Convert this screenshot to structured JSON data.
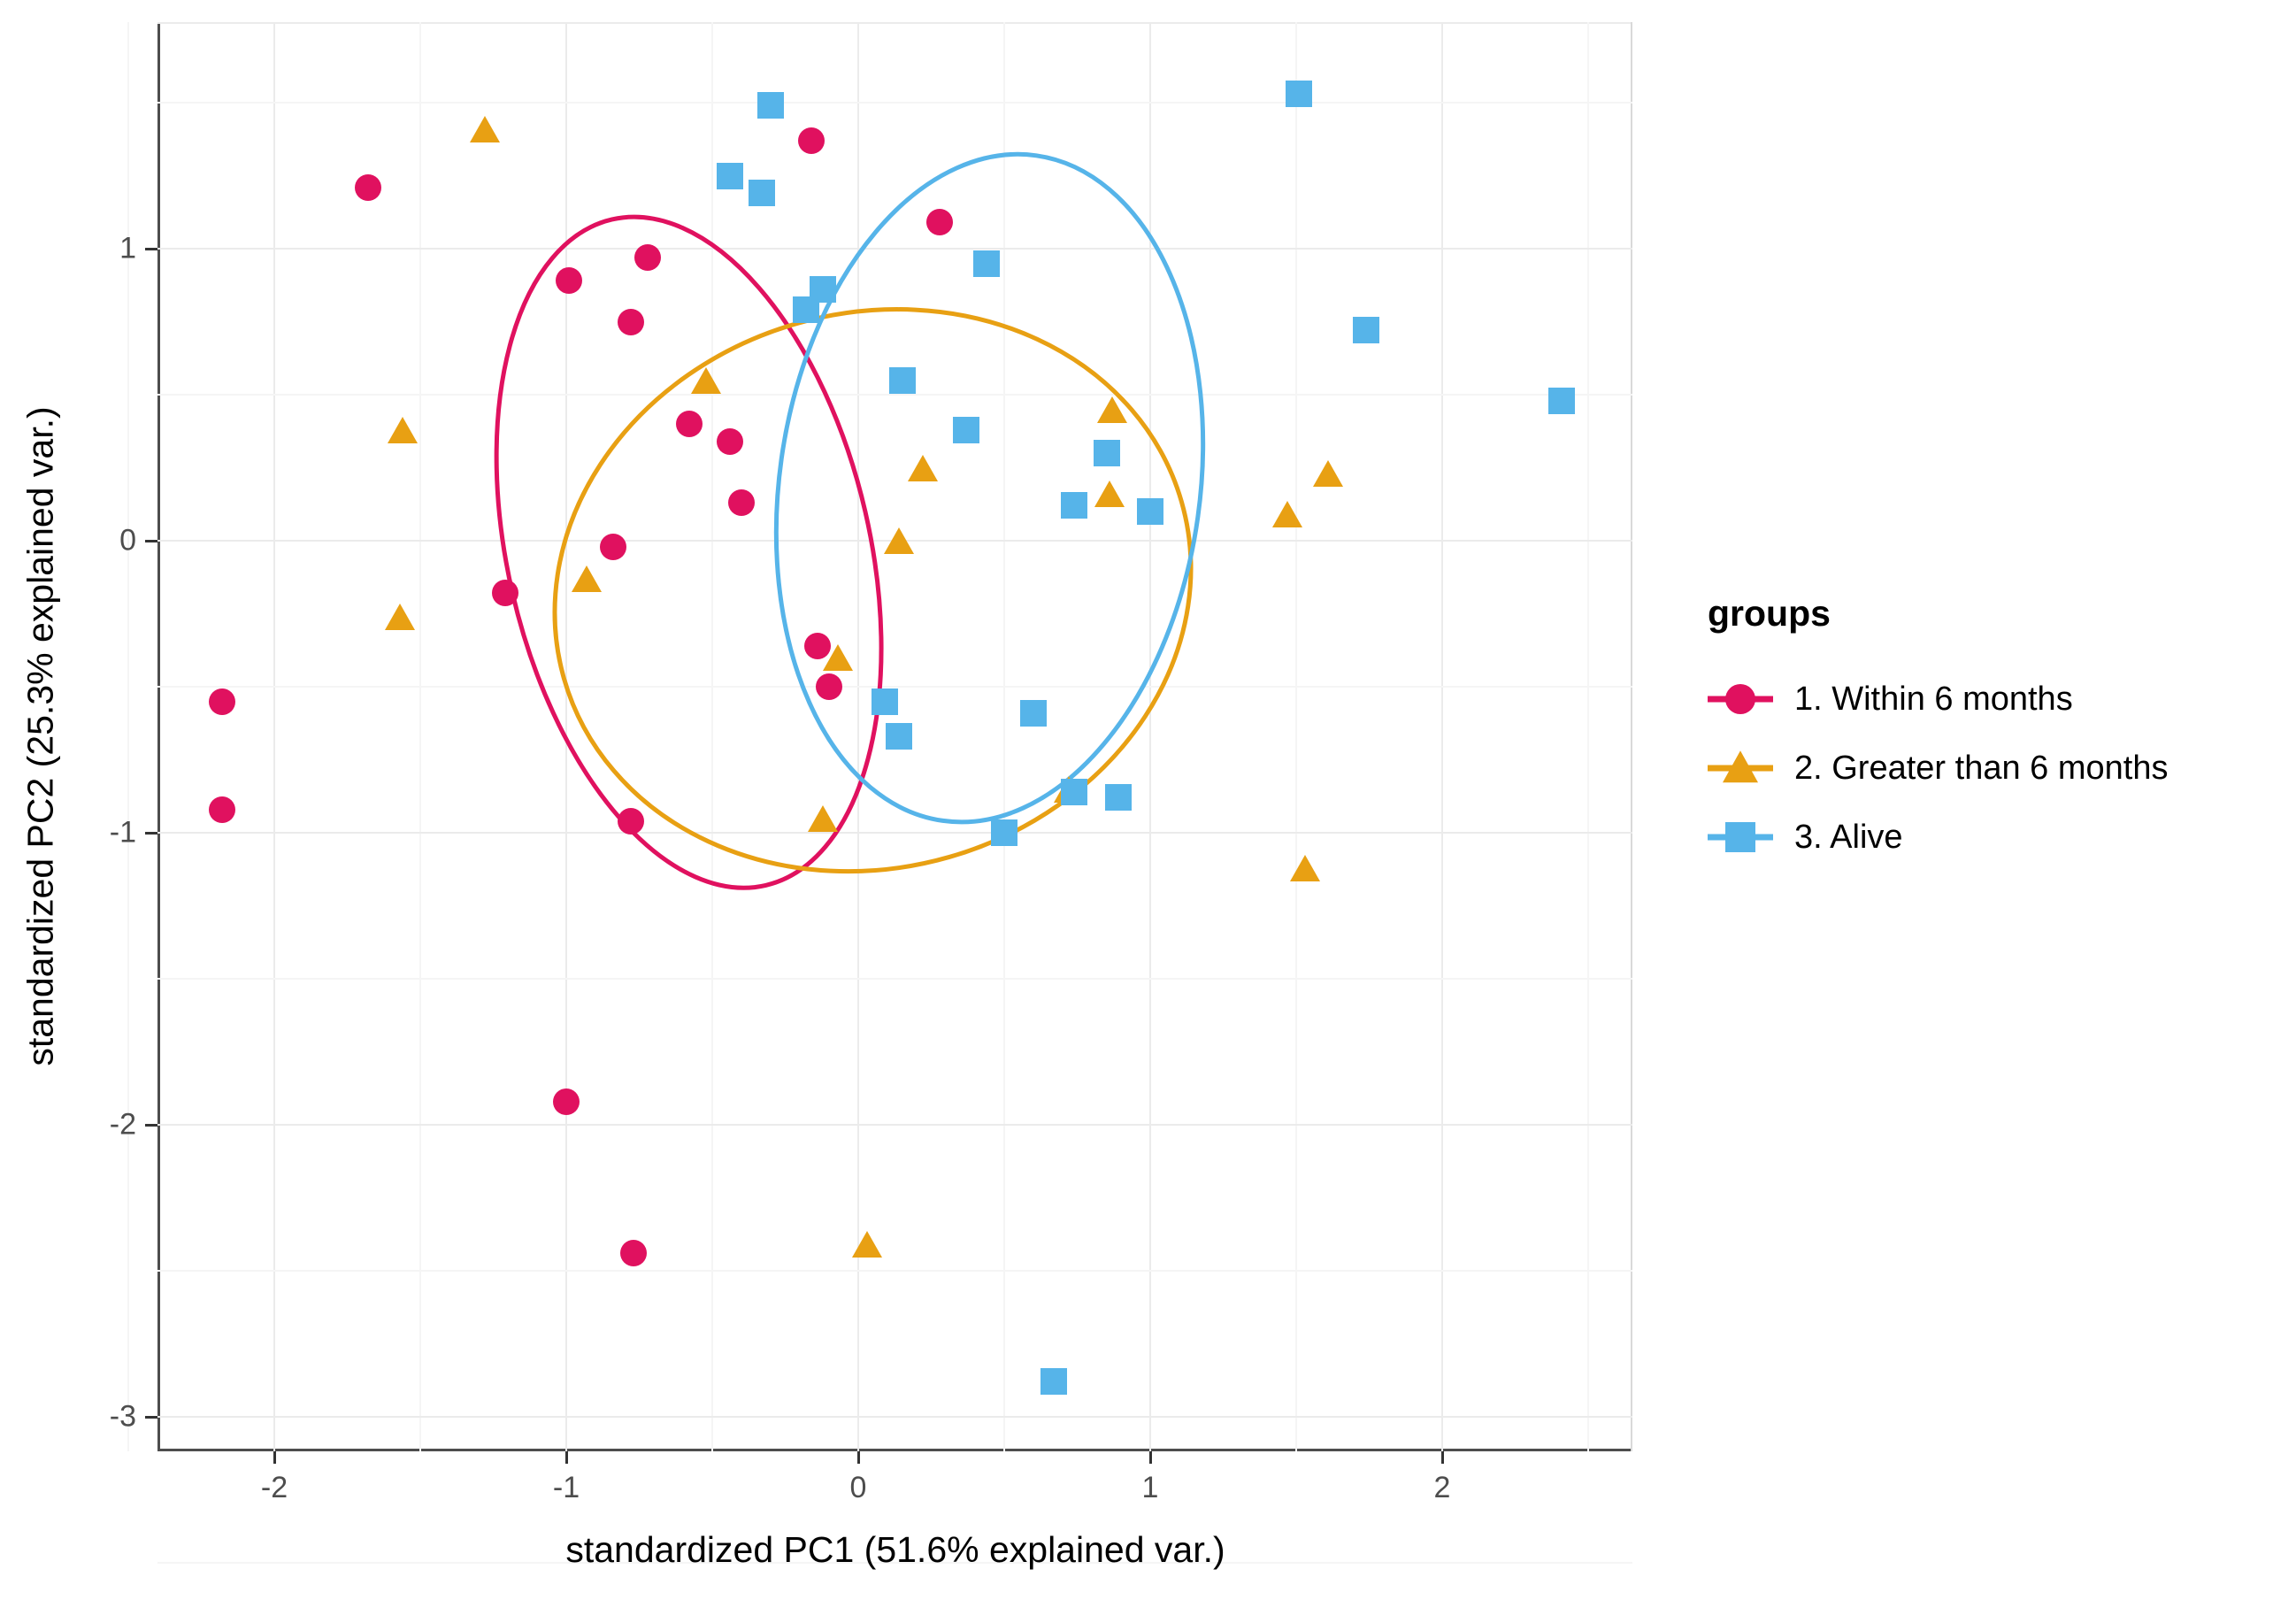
{
  "chart_data": {
    "type": "scatter",
    "title": "",
    "xlabel": "standardized PC1 (51.6% explained var.)",
    "ylabel": "standardized PC2 (25.3% explained var.)",
    "xlim": [
      -2.4,
      2.6
    ],
    "ylim": [
      -3.15,
      1.65
    ],
    "xticks": [
      "-2",
      "-1",
      "0",
      "1",
      "2"
    ],
    "xtick_values": [
      -2,
      -1,
      0,
      1,
      2
    ],
    "yticks": [
      "1",
      "0",
      "-1",
      "-2",
      "-3"
    ],
    "ytick_values": [
      1,
      0,
      -1,
      -2,
      -3
    ],
    "grid": true,
    "legend_position": "right",
    "legend_title": "groups",
    "colors": {
      "group1": "#E0115F",
      "group2": "#E8A013",
      "group3": "#56B4E9"
    },
    "series": [
      {
        "name": "1. Within 6 months",
        "marker": "circle",
        "color": "#E0115F",
        "points": [
          [
            -1.68,
            1.21
          ],
          [
            -0.16,
            1.37
          ],
          [
            -0.99,
            0.89
          ],
          [
            -0.72,
            0.97
          ],
          [
            -0.78,
            0.75
          ],
          [
            0.28,
            1.09
          ],
          [
            -0.58,
            0.4
          ],
          [
            -0.44,
            0.34
          ],
          [
            -0.4,
            0.13
          ],
          [
            -0.84,
            -0.02
          ],
          [
            -1.21,
            -0.18
          ],
          [
            -2.18,
            -0.55
          ],
          [
            -2.18,
            -0.92
          ],
          [
            -0.14,
            -0.36
          ],
          [
            -0.1,
            -0.5
          ],
          [
            -0.78,
            -0.96
          ],
          [
            -1.0,
            -1.92
          ],
          [
            -0.77,
            -2.44
          ]
        ]
      },
      {
        "name": "2. Greater than 6 months",
        "marker": "triangle",
        "color": "#E8A013",
        "points": [
          [
            -1.28,
            1.41
          ],
          [
            -1.56,
            0.38
          ],
          [
            -0.52,
            0.55
          ],
          [
            -0.93,
            -0.13
          ],
          [
            -1.57,
            -0.26
          ],
          [
            0.22,
            0.25
          ],
          [
            0.14,
            0.0
          ],
          [
            0.87,
            0.45
          ],
          [
            0.86,
            0.16
          ],
          [
            1.61,
            0.23
          ],
          [
            1.47,
            0.09
          ],
          [
            -0.07,
            -0.4
          ],
          [
            0.72,
            -0.85
          ],
          [
            -0.12,
            -0.95
          ],
          [
            1.53,
            -1.12
          ],
          [
            0.03,
            -2.41
          ]
        ]
      },
      {
        "name": "3. Alive",
        "marker": "square",
        "color": "#56B4E9",
        "points": [
          [
            -0.3,
            1.49
          ],
          [
            1.51,
            1.53
          ],
          [
            -0.44,
            1.25
          ],
          [
            -0.33,
            1.19
          ],
          [
            -0.12,
            0.86
          ],
          [
            -0.18,
            0.79
          ],
          [
            0.44,
            0.95
          ],
          [
            1.74,
            0.72
          ],
          [
            2.41,
            0.48
          ],
          [
            0.15,
            0.55
          ],
          [
            0.37,
            0.38
          ],
          [
            0.85,
            0.3
          ],
          [
            0.74,
            0.12
          ],
          [
            1.0,
            0.1
          ],
          [
            0.09,
            -0.55
          ],
          [
            0.14,
            -0.67
          ],
          [
            0.6,
            -0.59
          ],
          [
            0.74,
            -0.86
          ],
          [
            0.89,
            -0.88
          ],
          [
            0.5,
            -1.0
          ],
          [
            0.67,
            -2.88
          ]
        ]
      }
    ],
    "ellipses": [
      {
        "group": "1. Within 6 months",
        "color": "#E0115F",
        "cx": -0.58,
        "cy": -0.04,
        "rx": 0.62,
        "ry": 1.17,
        "rotate": -13
      },
      {
        "group": "2. Greater than 6 months",
        "color": "#E8A013",
        "cx": 0.05,
        "cy": -0.17,
        "rx": 1.1,
        "ry": 0.95,
        "rotate": -16
      },
      {
        "group": "3. Alive",
        "color": "#56B4E9",
        "cx": 0.45,
        "cy": 0.18,
        "rx": 0.72,
        "ry": 1.15,
        "rotate": 8
      }
    ]
  },
  "axis": {
    "x_title": "standardized PC1 (51.6% explained var.)",
    "y_title": "standardized PC2 (25.3% explained var.)"
  },
  "legend": {
    "title": "groups",
    "items": [
      {
        "label": "1. Within 6 months",
        "marker": "circle",
        "color": "#E0115F"
      },
      {
        "label": "2. Greater than 6 months",
        "marker": "triangle",
        "color": "#E8A013"
      },
      {
        "label": "3. Alive",
        "marker": "square",
        "color": "#56B4E9"
      }
    ]
  }
}
